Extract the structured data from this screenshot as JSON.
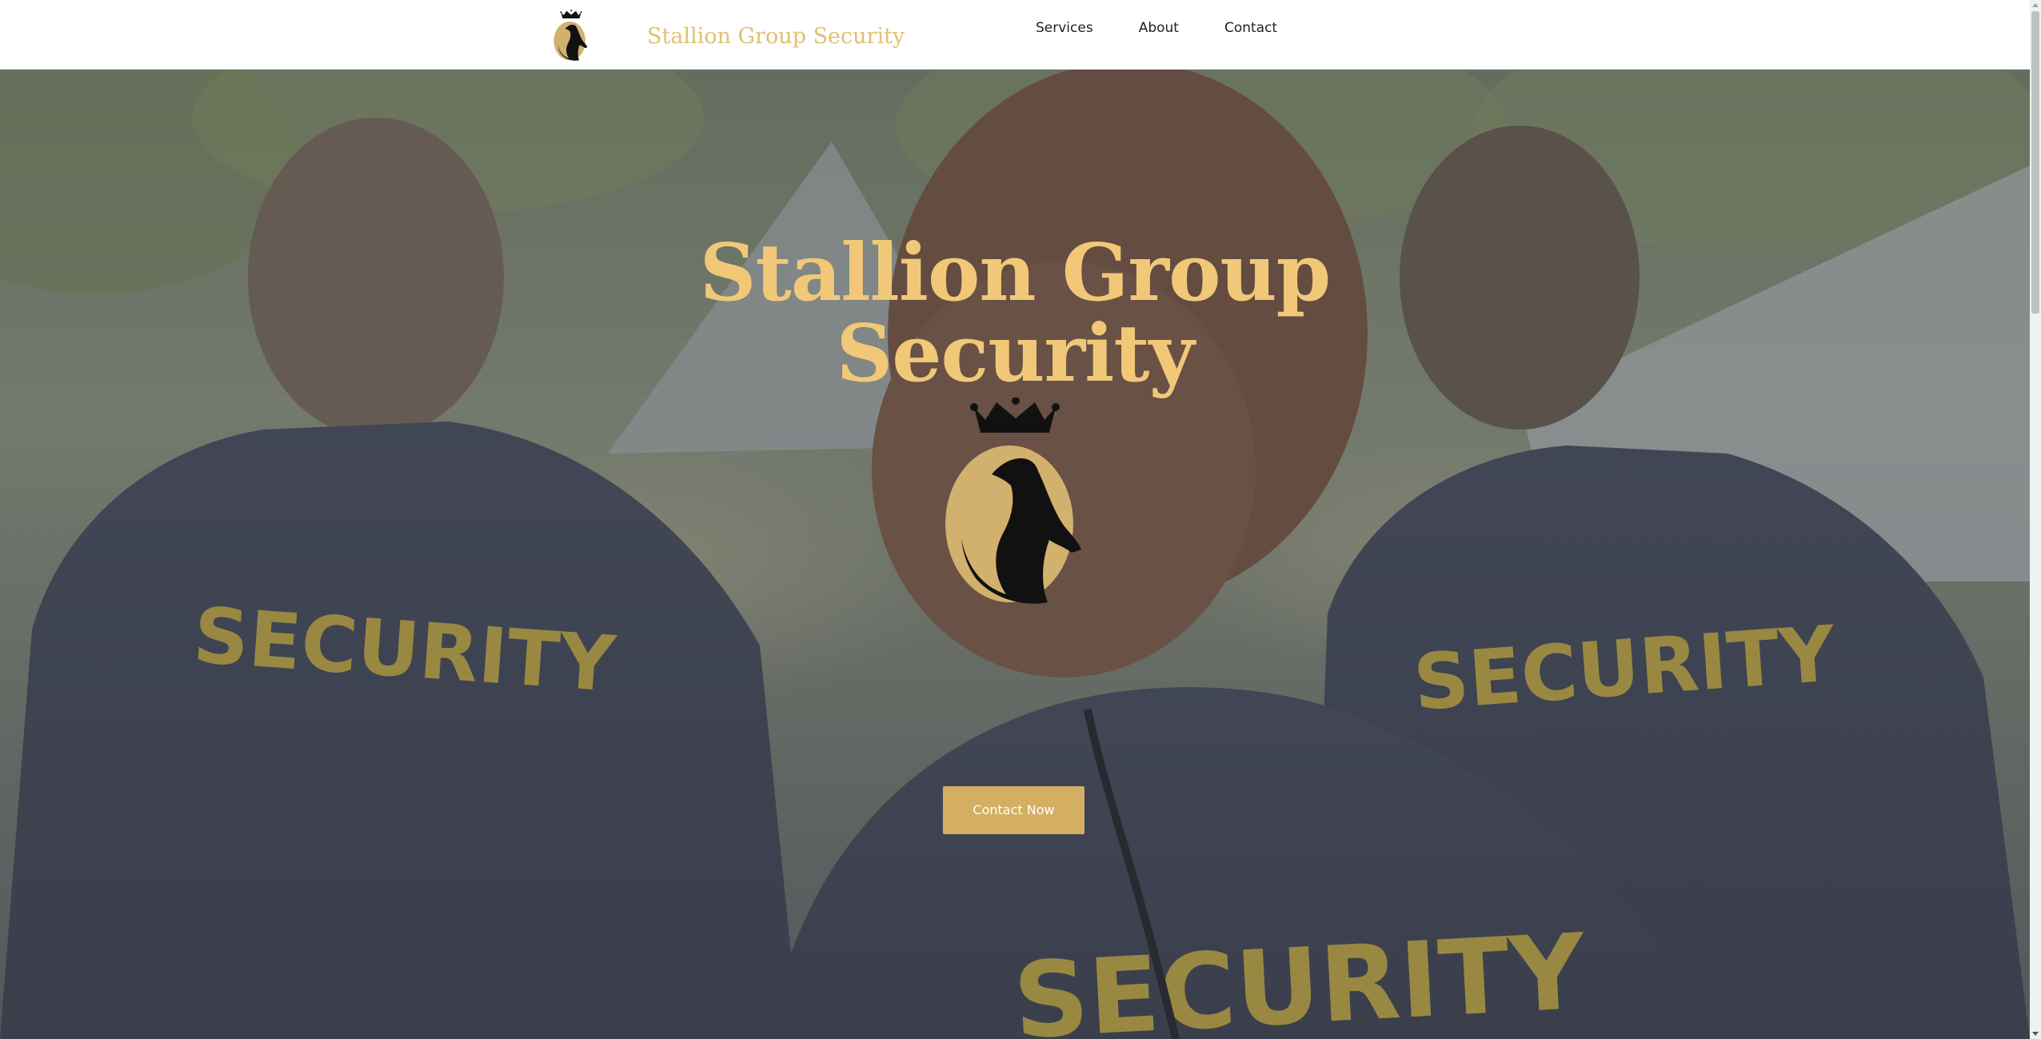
{
  "header": {
    "logo_icon": "stallion-crown-horse-icon",
    "brand_name": "Stallion Group Security",
    "nav": [
      {
        "label": "Services"
      },
      {
        "label": "About"
      },
      {
        "label": "Contact"
      }
    ]
  },
  "hero": {
    "background_image": "security-guards-at-outdoor-event",
    "title_line1": "Stallion Group",
    "title_line2": "Security",
    "logo_icon": "stallion-crown-horse-icon",
    "cta_label": "Contact Now"
  },
  "colors": {
    "brand_gold": "#e2c071",
    "title_gold": "#f0c878",
    "button_gold": "#d4ae63",
    "nav_text": "#1f1f1f"
  }
}
